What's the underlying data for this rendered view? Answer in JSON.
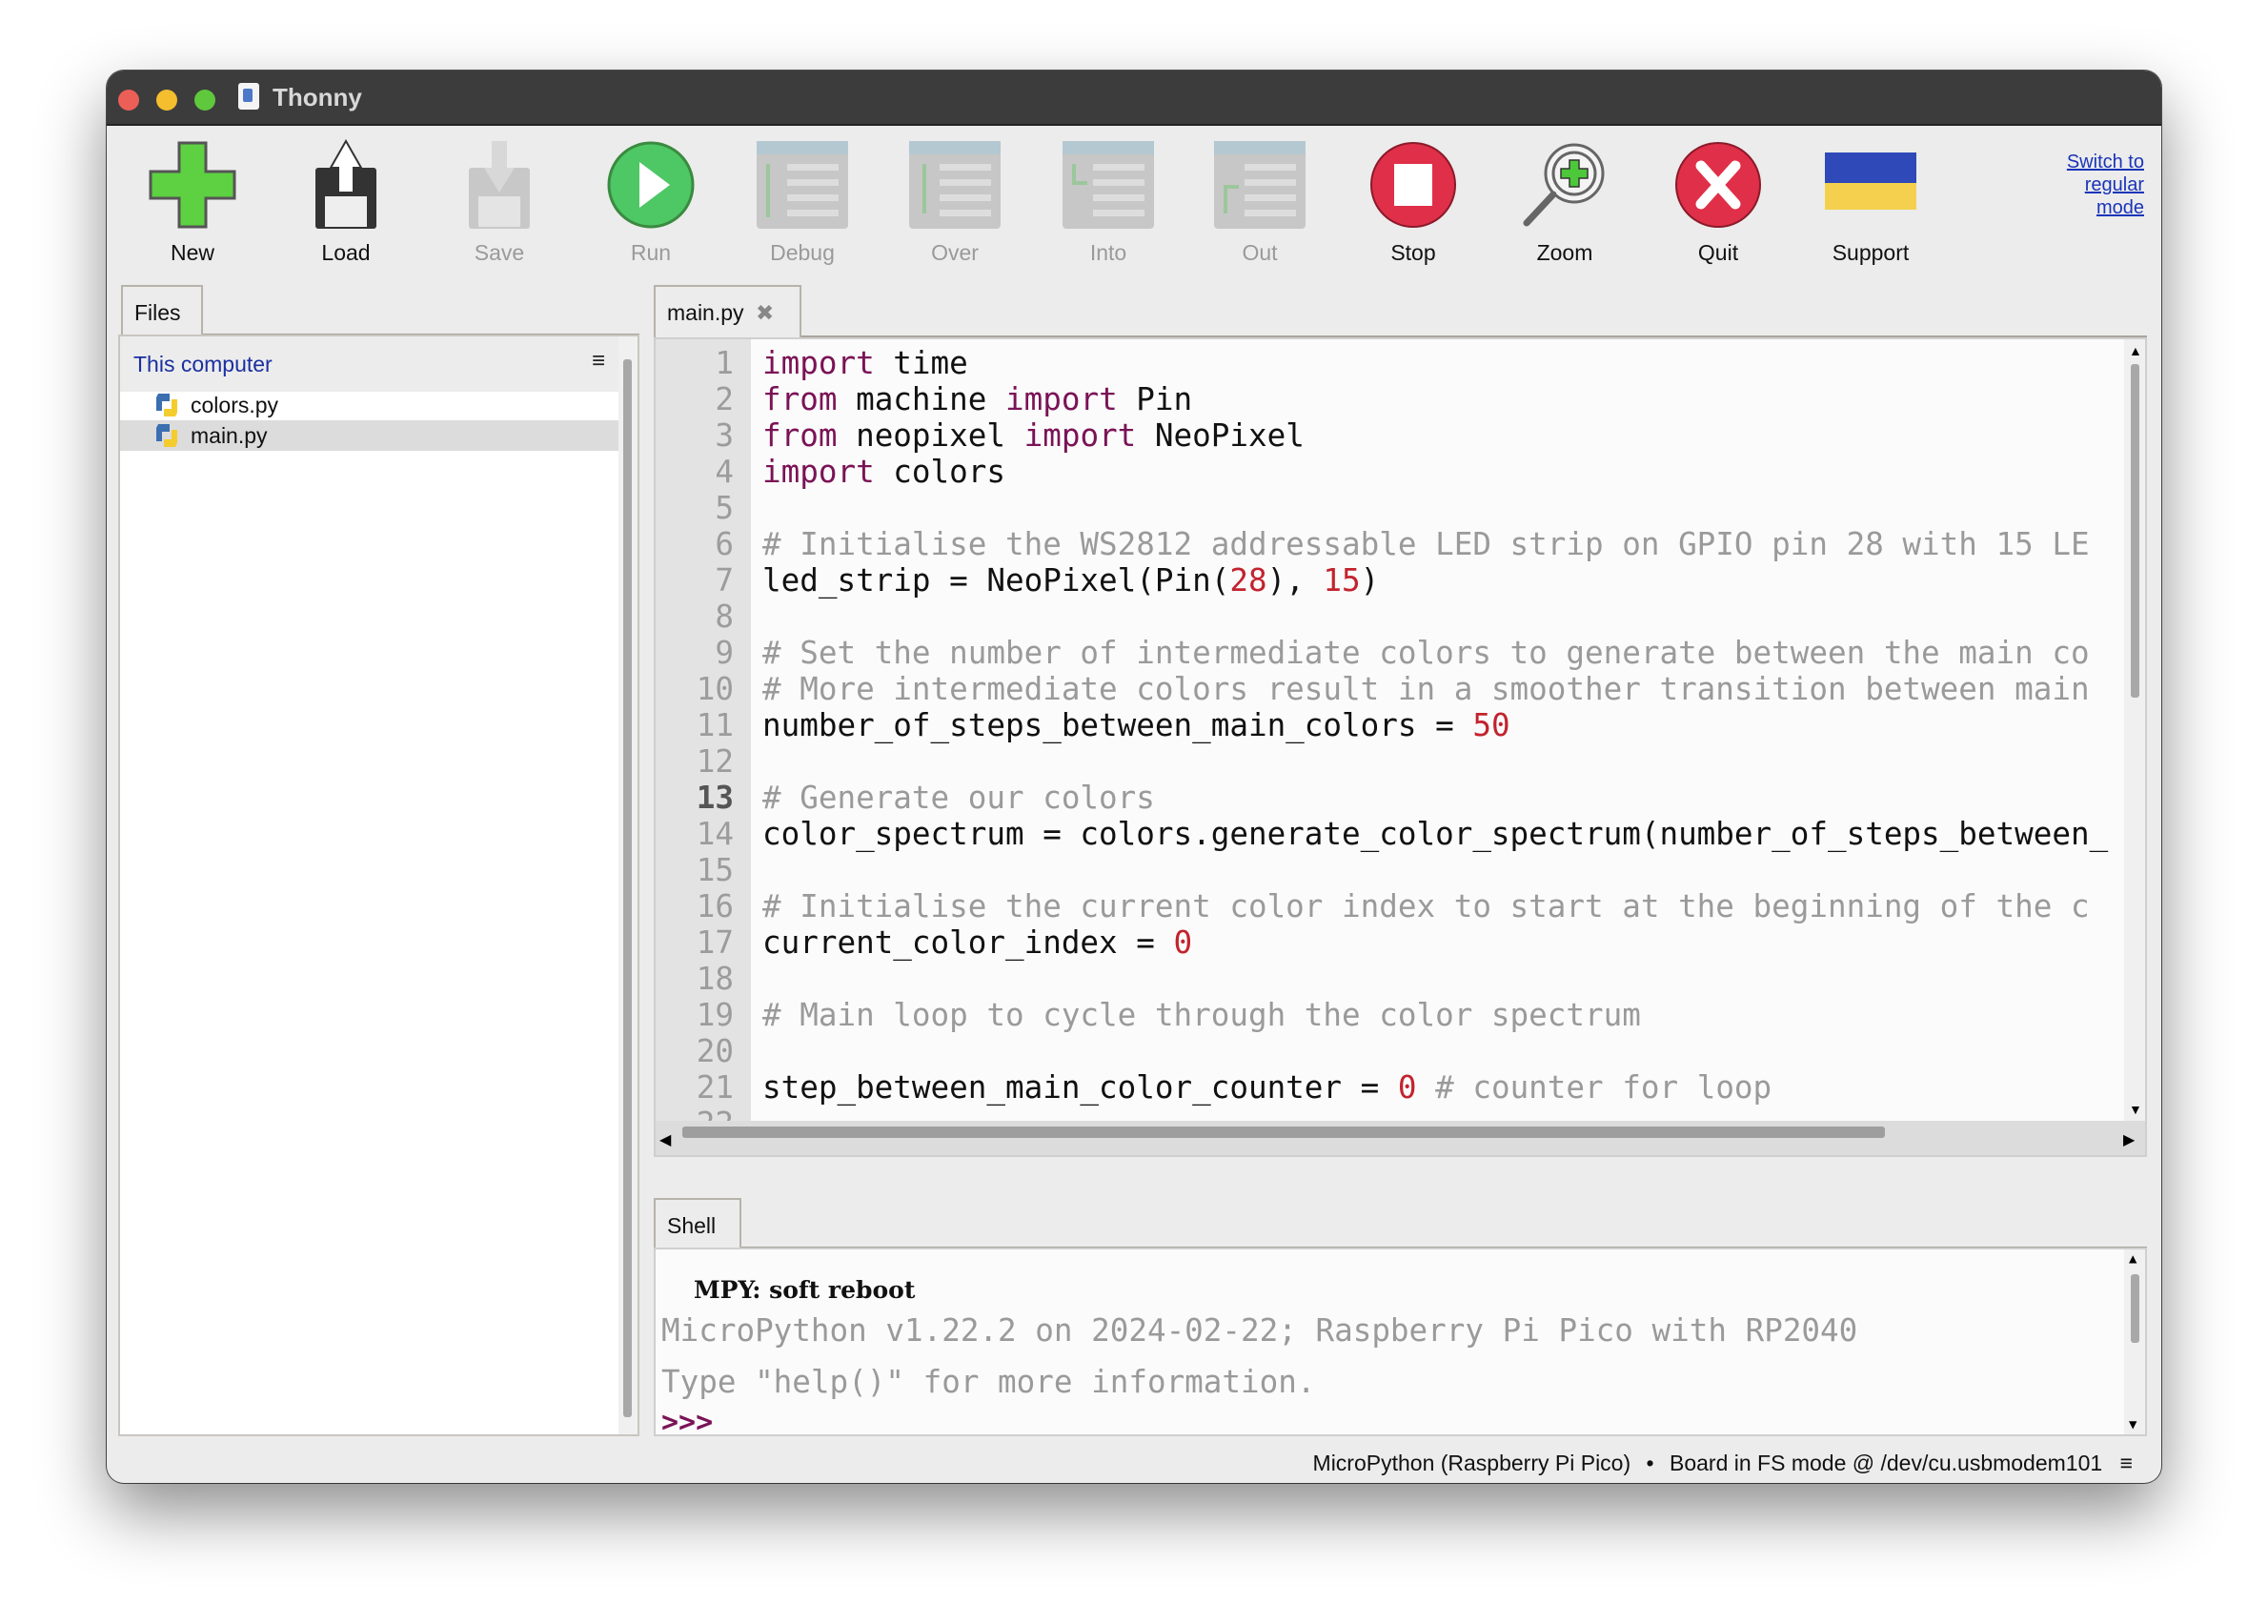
{
  "window": {
    "title": "Thonny",
    "traffic_lights": {
      "close": "#ec5f57",
      "minimize": "#f5be2e",
      "zoom": "#5fc83c"
    }
  },
  "toolbar": {
    "buttons": [
      {
        "id": "new",
        "label": "New",
        "icon": "green-plus-icon",
        "enabled": true
      },
      {
        "id": "load",
        "label": "Load",
        "icon": "floppy-load-icon",
        "enabled": true
      },
      {
        "id": "save",
        "label": "Save",
        "icon": "floppy-save-icon",
        "enabled": false
      },
      {
        "id": "run",
        "label": "Run",
        "icon": "run-play-icon",
        "enabled": false
      },
      {
        "id": "debug",
        "label": "Debug",
        "icon": "debug-icon",
        "enabled": false
      },
      {
        "id": "over",
        "label": "Over",
        "icon": "step-over-icon",
        "enabled": false
      },
      {
        "id": "into",
        "label": "Into",
        "icon": "step-into-icon",
        "enabled": false
      },
      {
        "id": "out",
        "label": "Out",
        "icon": "step-out-icon",
        "enabled": false
      },
      {
        "id": "stop",
        "label": "Stop",
        "icon": "stop-icon",
        "enabled": true
      },
      {
        "id": "zoom",
        "label": "Zoom",
        "icon": "zoom-magnifier-icon",
        "enabled": true
      },
      {
        "id": "quit",
        "label": "Quit",
        "icon": "quit-x-icon",
        "enabled": true
      },
      {
        "id": "support",
        "label": "Support",
        "icon": "ukraine-flag-icon",
        "enabled": true
      }
    ],
    "switch_mode": [
      "Switch to",
      "regular",
      "mode"
    ]
  },
  "files": {
    "tab": "Files",
    "location": "This computer",
    "menu_icon": "≡",
    "items": [
      {
        "name": "colors.py",
        "selected": false
      },
      {
        "name": "main.py",
        "selected": true
      }
    ]
  },
  "editor": {
    "tab": "main.py",
    "close_icon": "✖",
    "current_line": 13,
    "colors": {
      "keyword": "#7a1356",
      "number": "#c2232e",
      "comment": "#9a9a9a"
    },
    "lines": [
      [
        [
          "kw",
          "import"
        ],
        [
          "pl",
          " time"
        ]
      ],
      [
        [
          "kw",
          "from"
        ],
        [
          "pl",
          " machine "
        ],
        [
          "kw",
          "import"
        ],
        [
          "pl",
          " Pin"
        ]
      ],
      [
        [
          "kw",
          "from"
        ],
        [
          "pl",
          " neopixel "
        ],
        [
          "kw",
          "import"
        ],
        [
          "pl",
          " NeoPixel"
        ]
      ],
      [
        [
          "kw",
          "import"
        ],
        [
          "pl",
          " colors"
        ]
      ],
      [],
      [
        [
          "cm",
          "# Initialise the WS2812 addressable LED strip on GPIO pin 28 with 15 LE"
        ]
      ],
      [
        [
          "pl",
          "led_strip = NeoPixel(Pin("
        ],
        [
          "num",
          "28"
        ],
        [
          "pl",
          "), "
        ],
        [
          "num",
          "15"
        ],
        [
          "pl",
          ")"
        ]
      ],
      [],
      [
        [
          "cm",
          "# Set the number of intermediate colors to generate between the main co"
        ]
      ],
      [
        [
          "cm",
          "# More intermediate colors result in a smoother transition between main"
        ]
      ],
      [
        [
          "pl",
          "number_of_steps_between_main_colors = "
        ],
        [
          "num",
          "50"
        ]
      ],
      [],
      [
        [
          "cm",
          "# Generate our colors"
        ]
      ],
      [
        [
          "pl",
          "color_spectrum = colors.generate_color_spectrum(number_of_steps_between_"
        ]
      ],
      [],
      [
        [
          "cm",
          "# Initialise the current color index to start at the beginning of the c"
        ]
      ],
      [
        [
          "pl",
          "current_color_index = "
        ],
        [
          "num",
          "0"
        ]
      ],
      [],
      [
        [
          "cm",
          "# Main loop to cycle through the color spectrum"
        ]
      ],
      [],
      [
        [
          "pl",
          "step_between_main_color_counter = "
        ],
        [
          "num",
          "0"
        ],
        [
          "cm",
          " # counter for loop"
        ]
      ],
      []
    ]
  },
  "shell": {
    "tab": "Shell",
    "lines": [
      "MPY: soft reboot",
      "MicroPython v1.22.2 on 2024-02-22; Raspberry Pi Pico with RP2040",
      "Type \"help()\" for more information."
    ],
    "prompt": ">>>"
  },
  "status": {
    "interpreter": "MicroPython (Raspberry Pi Pico)",
    "separator": "•",
    "board": "Board in FS mode @ /dev/cu.usbmodem101",
    "menu_icon": "≡"
  }
}
